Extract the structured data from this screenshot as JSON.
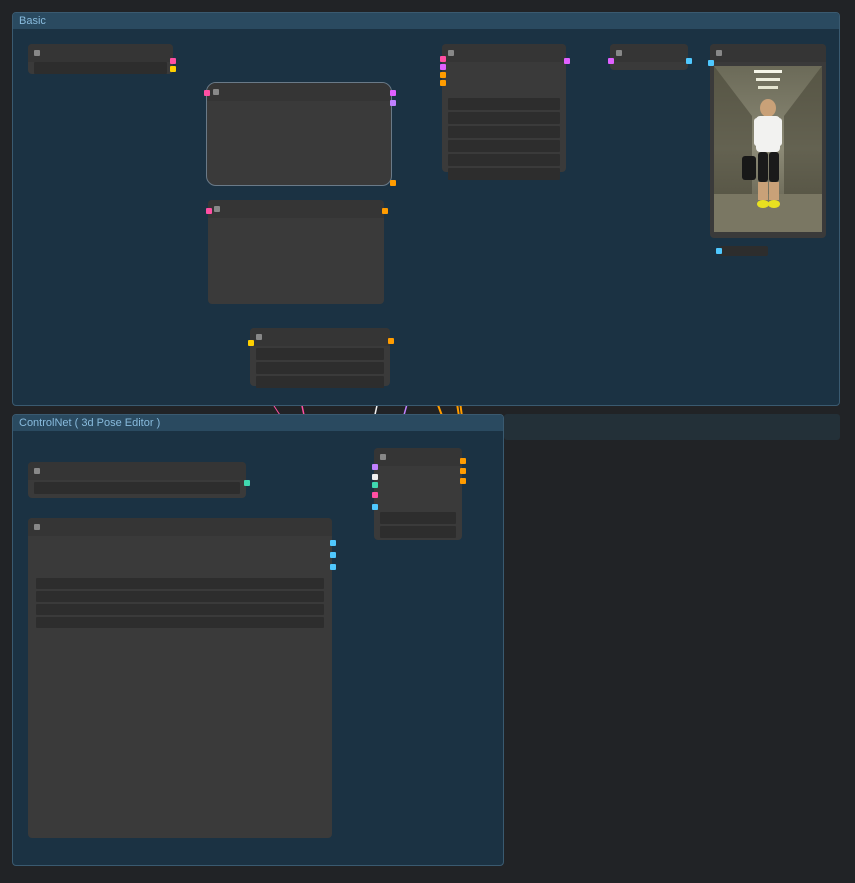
{
  "groups": {
    "basic": {
      "title": "Basic"
    },
    "controlnet": {
      "title": "ControlNet ( 3d Pose Editor )"
    }
  },
  "colors": {
    "group_bg": "#1b3243",
    "group_header": "#2a4a60",
    "node_bg": "#3a3a3a",
    "wire_yellow": "#ffd000",
    "wire_orange": "#ff9c00",
    "wire_pink": "#ff4fa3",
    "wire_magenta": "#e060ff",
    "wire_violet": "#c080ff",
    "wire_white": "#f0f0f0",
    "wire_cyan": "#4fc8ff",
    "wire_teal": "#40d8b0"
  }
}
